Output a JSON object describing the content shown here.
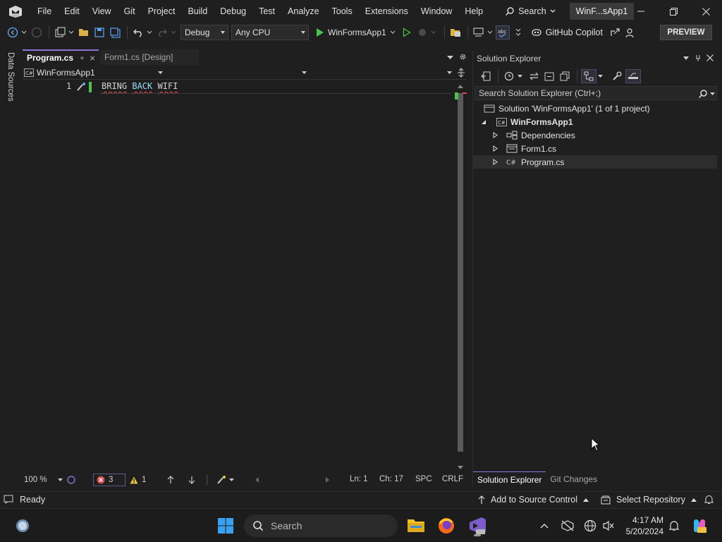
{
  "menu": {
    "items": [
      "File",
      "Edit",
      "View",
      "Git",
      "Project",
      "Build",
      "Debug",
      "Test",
      "Analyze",
      "Tools",
      "Extensions",
      "Window",
      "Help"
    ],
    "search_label": "Search",
    "window_title": "WinF...sApp1"
  },
  "toolbar": {
    "configuration": "Debug",
    "platform": "Any CPU",
    "run_target": "WinFormsApp1",
    "copilot_label": "GitHub Copilot",
    "preview_label": "PREVIEW"
  },
  "left_strip": {
    "label": "Data Sources"
  },
  "editor": {
    "tabs": [
      {
        "label": "Program.cs",
        "active": true
      },
      {
        "label": "Form1.cs [Design]",
        "active": false
      }
    ],
    "nav_project": "WinFormsApp1",
    "line_number": "1",
    "code_words": [
      "BRING",
      "BACK",
      "WIFI"
    ],
    "zoom": "100 %",
    "errors": "3",
    "warnings": "1",
    "ln": "Ln: 1",
    "ch": "Ch: 17",
    "spc": "SPC",
    "eol": "CRLF"
  },
  "solution_explorer": {
    "title": "Solution Explorer",
    "search_placeholder": "Search Solution Explorer (Ctrl+;)",
    "solution_label": "Solution 'WinFormsApp1' (1 of 1 project)",
    "project_label": "WinFormsApp1",
    "items": [
      {
        "label": "Dependencies",
        "icon": "dependencies-icon"
      },
      {
        "label": "Form1.cs",
        "icon": "form-icon"
      },
      {
        "label": "Program.cs",
        "icon": "csharp-icon"
      }
    ],
    "bottom_tabs": [
      "Solution Explorer",
      "Git Changes"
    ]
  },
  "statusbar": {
    "ready": "Ready",
    "source_control": "Add to Source Control",
    "repository": "Select Repository"
  },
  "taskbar": {
    "search_placeholder": "Search",
    "time": "4:17 AM",
    "date": "5/20/2024"
  },
  "colors": {
    "accent": "#8c72d8",
    "error": "#d14b4b",
    "run_green": "#4ec24e"
  }
}
